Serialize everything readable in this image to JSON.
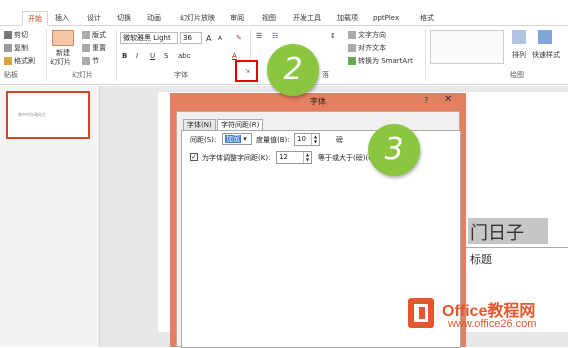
{
  "tabs": [
    "开始",
    "插入",
    "设计",
    "切换",
    "动画",
    "幻灯片放映",
    "审阅",
    "视图",
    "开发工具",
    "加载项",
    "pptPlex",
    "格式"
  ],
  "active_tab": "开始",
  "ribbon": {
    "clipboard": {
      "cut": "剪切",
      "copy": "复制",
      "format_painter": "格式刷",
      "label": "贴板"
    },
    "slides": {
      "new_slide": "新建",
      "new_slide2": "幻灯片",
      "layout": "版式",
      "reset": "重置",
      "section": "节",
      "label": "幻灯片"
    },
    "font": {
      "family": "微软雅黑 Light",
      "size": "36",
      "grow": "A",
      "shrink": "A",
      "label": "字体"
    },
    "paragraph": {
      "text_direction": "文字方向",
      "align_text": "对齐文本",
      "smartart": "转换为 SmartArt",
      "label": "落"
    },
    "arrange": "排列",
    "quick_styles": "快速样式",
    "drawing_label": "绘图"
  },
  "thumbnail_text": "各中代在政向大",
  "dialog": {
    "title": "字体",
    "help": "?",
    "close": "✕",
    "tab_font": "字体(N)",
    "tab_spacing": "字符间距(R)",
    "spacing_label": "间距(S):",
    "spacing_value": "加宽",
    "measure_label": "度量值(B):",
    "measure_value": "10",
    "unit": "磅",
    "kerning_label": "为字体调整字间距(K):",
    "kerning_value": "12",
    "kerning_suffix": "等于或大于(磅)(O)"
  },
  "slide_text_large": "门日子",
  "slide_subtitle": "标题",
  "callouts": [
    "2",
    "3"
  ],
  "watermark": {
    "brand": "Office教程网",
    "url": "www.office26.com"
  },
  "colors": {
    "accent": "#c43e1c",
    "dialog_frame": "#e47f5f",
    "callout": "#8cc540",
    "watermark": "#e4572e"
  }
}
